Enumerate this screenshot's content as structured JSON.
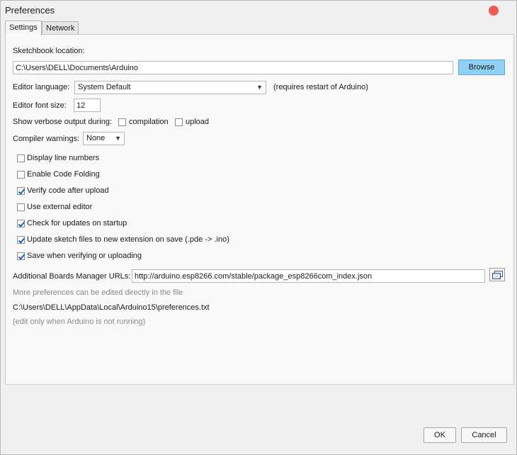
{
  "window": {
    "title": "Preferences"
  },
  "tabs": [
    {
      "label": "Settings",
      "active": true
    },
    {
      "label": "Network",
      "active": false
    }
  ],
  "settings": {
    "sketchbook_label": "Sketchbook location:",
    "sketchbook_path": "C:\\Users\\DELL\\Documents\\Arduino",
    "browse_label": "Browse",
    "editor_language_label": "Editor language:",
    "editor_language_value": "System Default",
    "editor_language_note": "(requires restart of Arduino)",
    "font_size_label": "Editor font size:",
    "font_size_value": "12",
    "verbose_label": "Show verbose output during:",
    "verbose_compilation": {
      "label": "compilation",
      "checked": false
    },
    "verbose_upload": {
      "label": "upload",
      "checked": false
    },
    "compiler_warnings_label": "Compiler warnings:",
    "compiler_warnings_value": "None",
    "options": [
      {
        "label": "Display line numbers",
        "checked": false
      },
      {
        "label": "Enable Code Folding",
        "checked": false
      },
      {
        "label": "Verify code after upload",
        "checked": true
      },
      {
        "label": "Use external editor",
        "checked": false
      },
      {
        "label": "Check for updates on startup",
        "checked": true
      },
      {
        "label": "Update sketch files to new extension on save (.pde -> .ino)",
        "checked": true
      },
      {
        "label": "Save when verifying or uploading",
        "checked": true
      }
    ],
    "boards_urls_label": "Additional Boards Manager URLs:",
    "boards_urls_value": "http://arduino.esp8266.com/stable/package_esp8266com_index.json",
    "more_prefs_text": "More preferences can be edited directly in the file",
    "prefs_path": "C:\\Users\\DELL\\AppData\\Local\\Arduino15\\preferences.txt",
    "edit_note": "(edit only when Arduino is not running)"
  },
  "footer": {
    "ok_label": "OK",
    "cancel_label": "Cancel"
  },
  "colors": {
    "accent": "#8fd0f5",
    "close": "#ec5c54",
    "check": "#1f5fbf"
  }
}
